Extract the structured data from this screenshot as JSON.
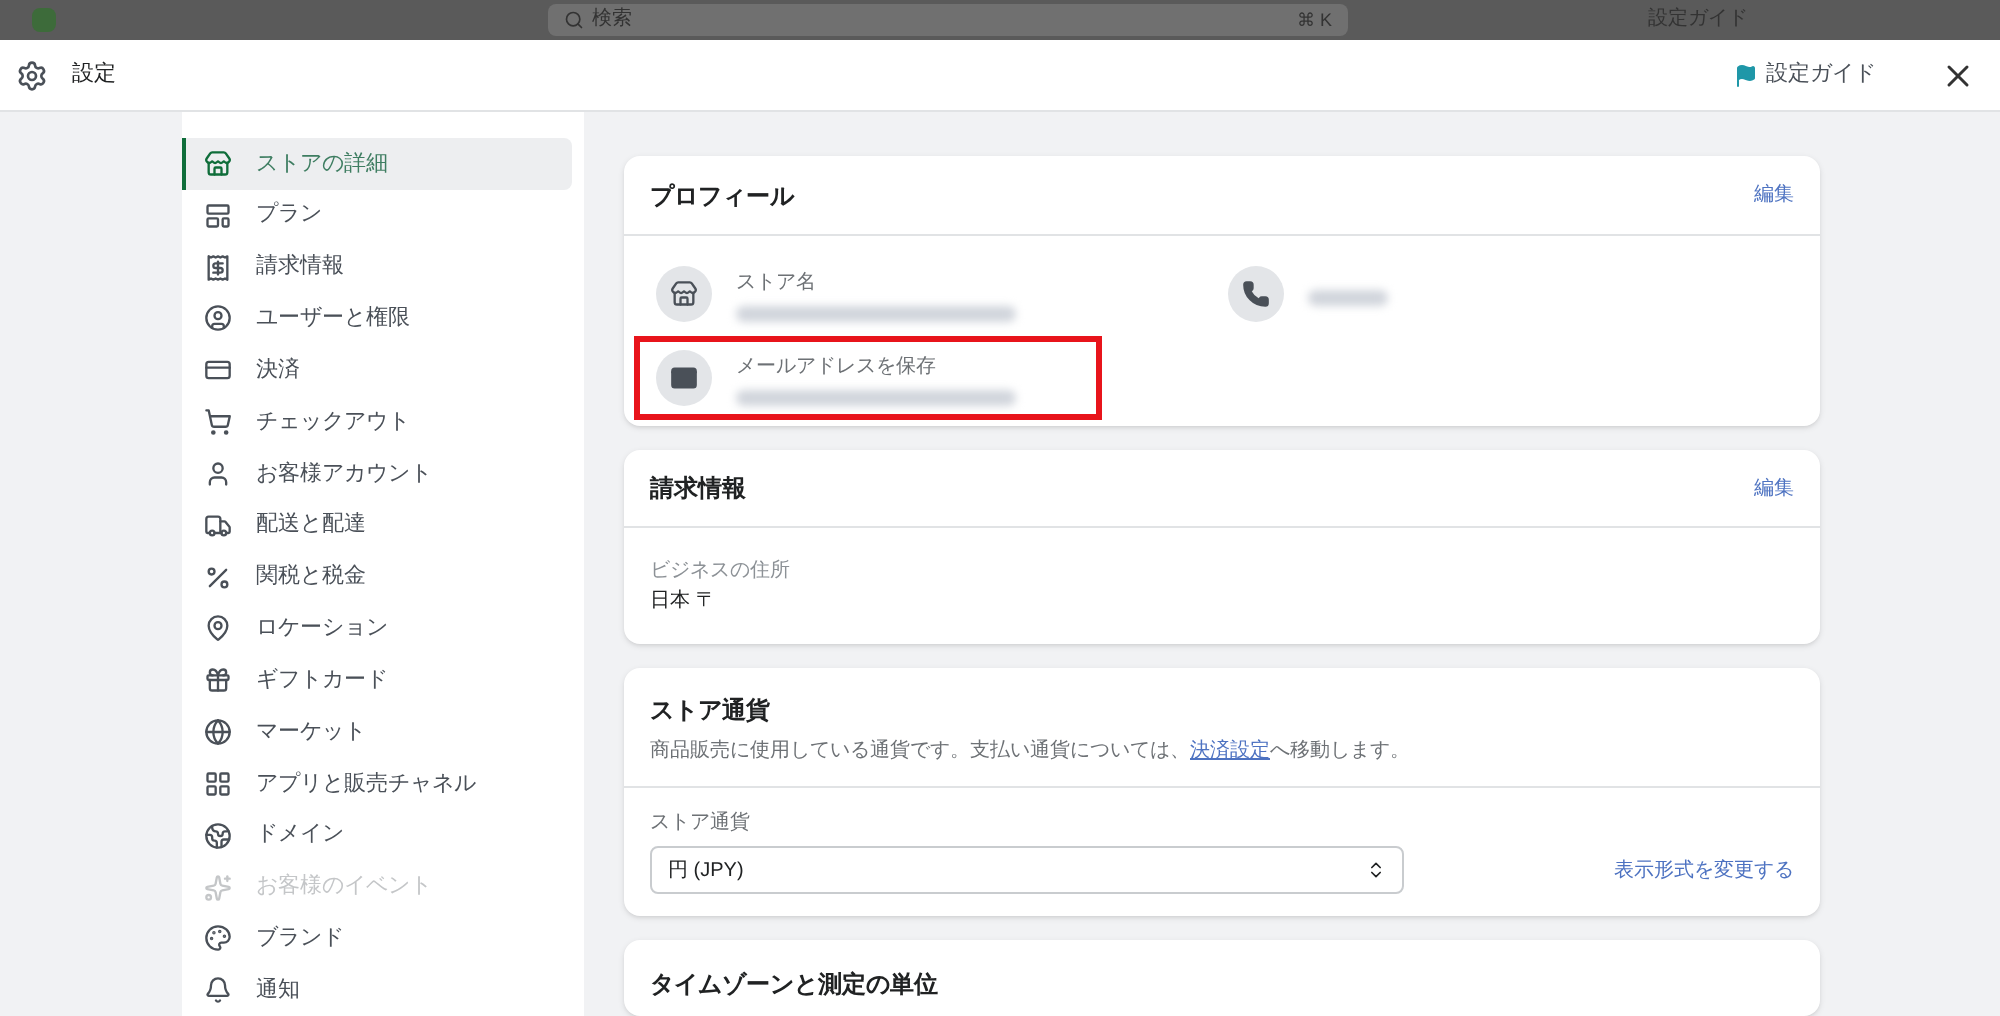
{
  "background_bar": {
    "search_placeholder": "検索",
    "shortcut": "⌘ K",
    "guide": "設定ガイド"
  },
  "window": {
    "title": "設定",
    "guide_link": "設定ガイド"
  },
  "sidebar": {
    "items": [
      {
        "label": "ストアの詳細",
        "selected": true,
        "disabled": false
      },
      {
        "label": "プラン",
        "selected": false,
        "disabled": false
      },
      {
        "label": "請求情報",
        "selected": false,
        "disabled": false
      },
      {
        "label": "ユーザーと権限",
        "selected": false,
        "disabled": false
      },
      {
        "label": "決済",
        "selected": false,
        "disabled": false
      },
      {
        "label": "チェックアウト",
        "selected": false,
        "disabled": false
      },
      {
        "label": "お客様アカウント",
        "selected": false,
        "disabled": false
      },
      {
        "label": "配送と配達",
        "selected": false,
        "disabled": false
      },
      {
        "label": "関税と税金",
        "selected": false,
        "disabled": false
      },
      {
        "label": "ロケーション",
        "selected": false,
        "disabled": false
      },
      {
        "label": "ギフトカード",
        "selected": false,
        "disabled": false
      },
      {
        "label": "マーケット",
        "selected": false,
        "disabled": false
      },
      {
        "label": "アプリと販売チャネル",
        "selected": false,
        "disabled": false
      },
      {
        "label": "ドメイン",
        "selected": false,
        "disabled": false
      },
      {
        "label": "お客様のイベント",
        "selected": false,
        "disabled": true
      },
      {
        "label": "ブランド",
        "selected": false,
        "disabled": false
      },
      {
        "label": "通知",
        "selected": false,
        "disabled": false
      }
    ]
  },
  "profile": {
    "title": "プロフィール",
    "edit": "編集",
    "fields": [
      {
        "kind": "store",
        "label": "ストア名",
        "highlighted": false
      },
      {
        "kind": "phone",
        "highlighted": false
      },
      {
        "kind": "email",
        "label": "メールアドレスを保存",
        "highlighted": true
      }
    ]
  },
  "billing": {
    "title": "請求情報",
    "edit": "編集",
    "address_label": "ビジネスの住所",
    "address": "日本 〒"
  },
  "currency": {
    "title": "ストア通貨",
    "description_before": "商品販売に使用している通貨です。支払い通貨については、",
    "description_link": "決済設定",
    "description_after": "へ移動します。",
    "select_label": "ストア通貨",
    "select_value": "円 (JPY)",
    "format_link": "表示形式を変更する"
  },
  "timezone": {
    "title": "タイムゾーンと測定の単位"
  }
}
